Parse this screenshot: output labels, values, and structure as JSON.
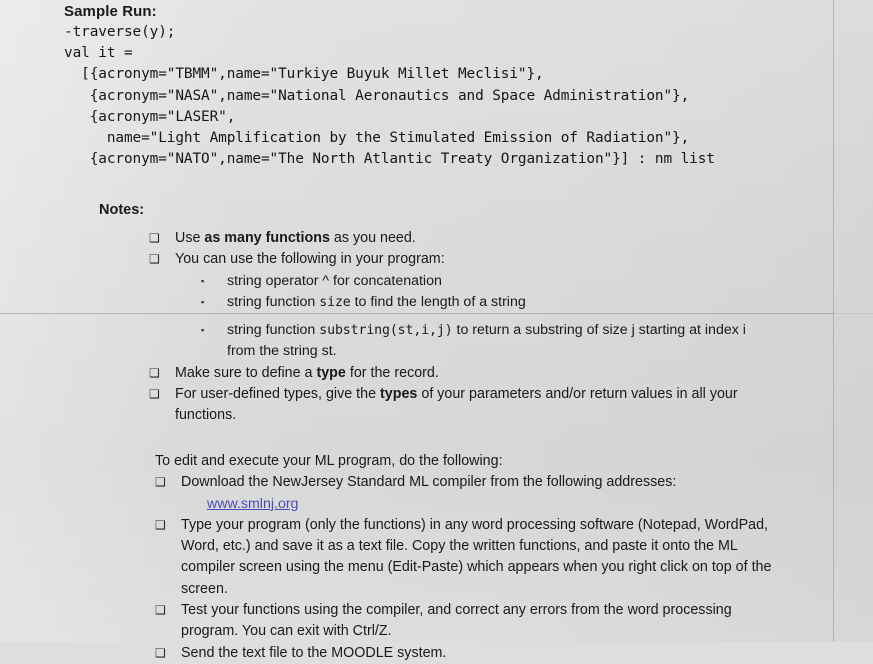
{
  "document": {
    "sample_run": {
      "heading": "Sample Run:",
      "code": "-traverse(y);\nval it =\n  [{acronym=\"TBMM\",name=\"Turkiye Buyuk Millet Meclisi\"},\n   {acronym=\"NASA\",name=\"National Aeronautics and Space Administration\"},\n   {acronym=\"LASER\",\n     name=\"Light Amplification by the Stimulated Emission of Radiation\"},\n   {acronym=\"NATO\",name=\"The North Atlantic Treaty Organization\"}] : nm list"
    },
    "notes": {
      "heading": "Notes:",
      "items": [
        {
          "bullet": "hollow-square",
          "text_before": "Use ",
          "bold": "as many functions",
          "text_after": " as you need."
        },
        {
          "bullet": "hollow-square",
          "text": "You can use the following in your program:"
        }
      ],
      "sub_items": [
        {
          "bullet": "filled-square",
          "text_before": "string operator ^ for concatenation",
          "mono": "",
          "text_after": ""
        },
        {
          "bullet": "filled-square",
          "text_before": "string function ",
          "mono": "size",
          "text_after": " to find the length of a string"
        }
      ],
      "sub_items_cont": [
        {
          "bullet": "filled-square",
          "text_before": "string function ",
          "mono": "substring(st,i,j)",
          "text_after": " to return a substring of size j starting at index i from the string st."
        }
      ],
      "items_cont": [
        {
          "bullet": "hollow-square",
          "text_before": "Make sure to define a ",
          "bold": "type",
          "text_after": " for the record."
        },
        {
          "bullet": "hollow-square",
          "text_before": "For user-defined types, give the ",
          "bold": "types",
          "text_after": " of your parameters and/or return values in all your functions."
        }
      ]
    },
    "execution": {
      "lead": "To edit and execute your ML program, do the following:",
      "items": [
        {
          "bullet": "hollow-square",
          "text": "Download the NewJersey Standard ML compiler from the following addresses:",
          "link": "www.smlnj.org"
        },
        {
          "bullet": "hollow-square",
          "text": "Type your program (only the functions) in any word processing software (Notepad, WordPad, Word, etc.) and save it as a text file. Copy the written functions, and paste it onto the ML compiler screen using the menu (Edit-Paste) which appears when you right click on top of the screen."
        },
        {
          "bullet": "hollow-square",
          "text": "Test your functions using the compiler, and correct any errors from the word processing program. You can exit with Ctrl/Z."
        },
        {
          "bullet": "hollow-square",
          "text": "Send the text file to the MOODLE system."
        }
      ]
    },
    "glyphs": {
      "hollow_square": "❑",
      "filled_square": "▪"
    },
    "colors": {
      "paper": "#dcdcdd",
      "text": "#1a1a1a",
      "link": "#4b4bb4",
      "seam": "#787880"
    }
  }
}
